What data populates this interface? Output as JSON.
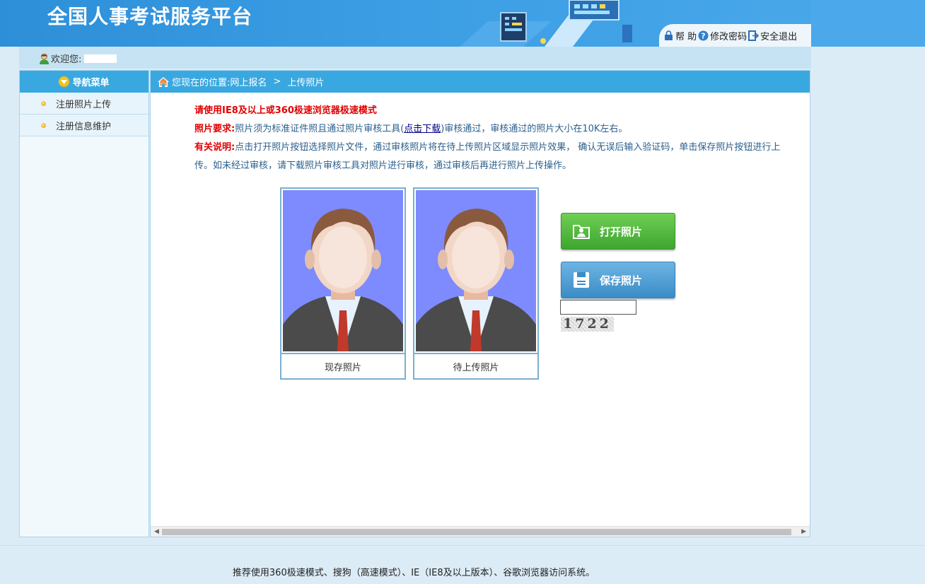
{
  "header": {
    "title": "全国人事考试服务平台",
    "links": {
      "help": "帮 助",
      "change_password": "修改密码",
      "logout": "安全退出"
    }
  },
  "welcome": {
    "label": "欢迎您:"
  },
  "sidebar": {
    "title": "导航菜单",
    "items": [
      {
        "label": "注册照片上传"
      },
      {
        "label": "注册信息维护"
      }
    ]
  },
  "breadcrumb": {
    "prefix": "您现在的位置:",
    "parts": [
      "网上报名",
      "上传照片"
    ],
    "separator": ">"
  },
  "notes": {
    "browser_tip": "请使用IE8及以上或360极速浏览器极速模式",
    "req_label": "照片要求:",
    "req_text_1": "照片须为标准证件照且通过照片审核工具(",
    "download_link": "点击下载",
    "req_text_2": ")审核通过，审核通过的照片大小在10K左右。",
    "info_label": "有关说明:",
    "info_text": "点击打开照片按钮选择照片文件，通过审核照片将在待上传照片区域显示照片效果， 确认无误后输入验证码，单击保存照片按钮进行上传。如未经过审核，请下载照片审核工具对照片进行审核，通过审核后再进行照片上传操作。"
  },
  "photos": {
    "current_caption": "现存照片",
    "pending_caption": "待上传照片"
  },
  "buttons": {
    "open": "打开照片",
    "save": "保存照片"
  },
  "captcha": {
    "value": "",
    "code": "1722"
  },
  "footer": {
    "text": "推荐使用360极速模式、搜狗（高速模式）、IE（IE8及以上版本）、谷歌浏览器访问系统。"
  },
  "colors": {
    "header_blue": "#3c9ee4",
    "nav_blue": "#3aa8e0",
    "alert_red": "#e00000",
    "green_btn": "#4fb83b",
    "blue_btn": "#4a9bd3"
  }
}
